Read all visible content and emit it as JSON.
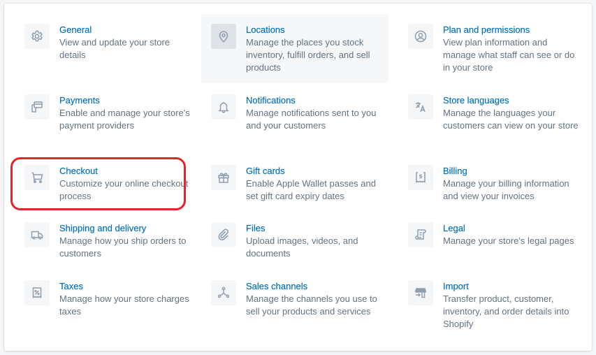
{
  "settings": {
    "items": [
      {
        "title": "General",
        "description": "View and update your store details",
        "icon": "gear-icon"
      },
      {
        "title": "Locations",
        "description": "Manage the places you stock inventory, fulfill orders, and sell products",
        "icon": "location-pin-icon",
        "state": "hover"
      },
      {
        "title": "Plan and permissions",
        "description": "View plan information and manage what staff can see or do in your store",
        "icon": "user-circle-icon"
      },
      {
        "title": "Payments",
        "description": "Enable and manage your store's payment providers",
        "icon": "payments-icon"
      },
      {
        "title": "Notifications",
        "description": "Manage notifications sent to you and your customers",
        "icon": "bell-icon"
      },
      {
        "title": "Store languages",
        "description": "Manage the languages your customers can view on your store",
        "icon": "translate-icon"
      },
      {
        "title": "Checkout",
        "description": "Customize your online checkout process",
        "icon": "cart-icon",
        "annotation": "red-outline"
      },
      {
        "title": "Gift cards",
        "description": "Enable Apple Wallet passes and set gift card expiry dates",
        "icon": "gift-icon"
      },
      {
        "title": "Billing",
        "description": "Manage your billing information and view your invoices",
        "icon": "billing-icon"
      },
      {
        "title": "Shipping and delivery",
        "description": "Manage how you ship orders to customers",
        "icon": "truck-icon"
      },
      {
        "title": "Files",
        "description": "Upload images, videos, and documents",
        "icon": "paperclip-icon"
      },
      {
        "title": "Legal",
        "description": "Manage your store's legal pages",
        "icon": "legal-scroll-icon"
      },
      {
        "title": "Taxes",
        "description": "Manage how your store charges taxes",
        "icon": "tax-receipt-icon"
      },
      {
        "title": "Sales channels",
        "description": "Manage the channels you use to sell your products and services",
        "icon": "sales-channels-icon"
      },
      {
        "title": "Import",
        "description": "Transfer product, customer, inventory, and order details into Shopify",
        "icon": "import-icon"
      }
    ]
  },
  "colors": {
    "link": "#006fbb",
    "description": "#637381",
    "icon": "#919eab",
    "annotation": "#e8222a"
  }
}
